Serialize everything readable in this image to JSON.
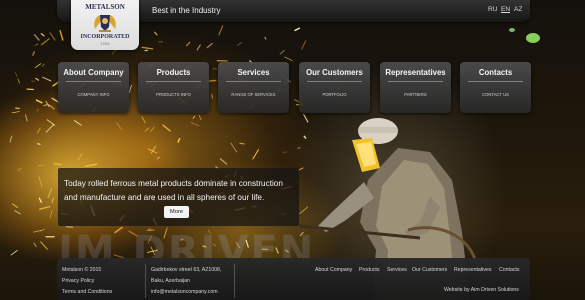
{
  "header": {
    "logo": {
      "top_text": "METALSON",
      "bottom_text": "INCORPORATED",
      "sub_text": "1995"
    },
    "tagline": "Best in the Industry",
    "languages": [
      "RU",
      "EN",
      "AZ"
    ],
    "active_language": "EN"
  },
  "nav": [
    {
      "title": "About Company",
      "sub": "COMPANY INFO"
    },
    {
      "title": "Products",
      "sub": "PRODUCTS INFO"
    },
    {
      "title": "Services",
      "sub": "RANGE OF SERVICES"
    },
    {
      "title": "Our Customers",
      "sub": "PORTFOLIO"
    },
    {
      "title": "Representatives",
      "sub": "PARTNERS"
    },
    {
      "title": "Contacts",
      "sub": "CONTACT US"
    }
  ],
  "promo": {
    "text": "Today rolled ferrous metal products dominate in construction and manufacture and are used in all spheres of our life.",
    "more_label": "More"
  },
  "background": {
    "watermark_text": "IM DRIVEN"
  },
  "footer": {
    "copyright": "Metalson © 2015",
    "privacy": "Privacy Policy",
    "terms": "Terms and Conditions",
    "address_line1": "Gadirbekov street 63, AZ1008,",
    "address_line2": "Baku, Azerbaijan",
    "email": "info@metalsoncompany.com",
    "links": [
      "About Company",
      "Products",
      "Services",
      "Our Customers",
      "Representatives",
      "Contacts"
    ],
    "credit": "Website by Aim Driven Solutions"
  },
  "colors": {
    "panel": "#2b2b2b",
    "spark": "#ffc83c",
    "text": "#ffffff",
    "logo_text": "#2a2f5a"
  }
}
